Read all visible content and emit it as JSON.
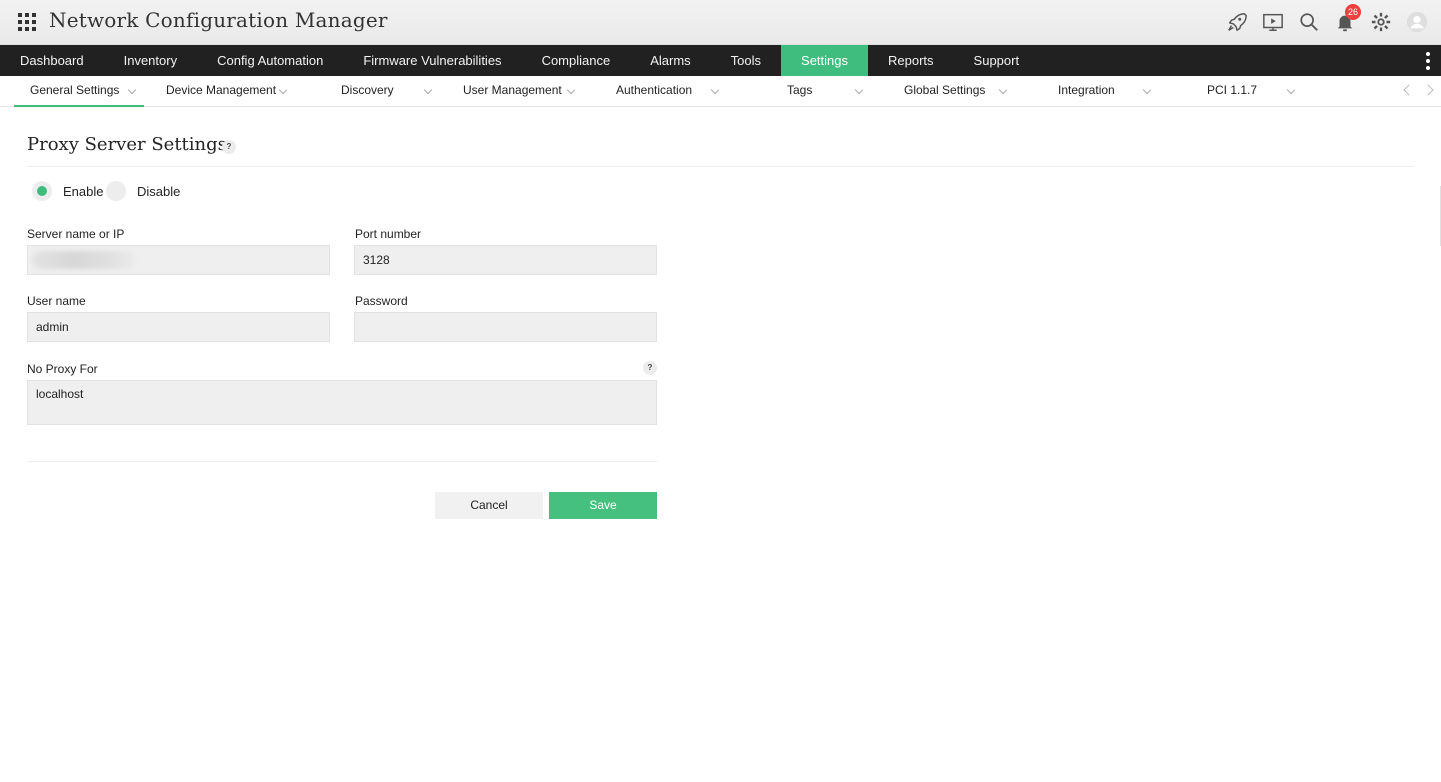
{
  "app": {
    "title": "Network Configuration Manager"
  },
  "header": {
    "icons": [
      "rocket-icon",
      "presentation-icon",
      "search-icon",
      "bell-icon",
      "gear-icon",
      "user-avatar-icon"
    ],
    "notification_count": "26"
  },
  "main_nav": {
    "items": [
      "Dashboard",
      "Inventory",
      "Config Automation",
      "Firmware Vulnerabilities",
      "Compliance",
      "Alarms",
      "Tools",
      "Settings",
      "Reports",
      "Support"
    ],
    "active": "Settings"
  },
  "sub_nav": {
    "items": [
      "General Settings",
      "Device Management",
      "Discovery",
      "User Management",
      "Authentication",
      "Tags",
      "Global Settings",
      "Integration",
      "PCI 1.1.7"
    ],
    "active": "General Settings"
  },
  "page": {
    "title": "Proxy Server Settings",
    "help_glyph": "?",
    "radio": {
      "enable_label": "Enable",
      "disable_label": "Disable",
      "selected": "Enable"
    },
    "fields": {
      "server": {
        "label": "Server name or IP",
        "value": ""
      },
      "port": {
        "label": "Port number",
        "value": "3128"
      },
      "username": {
        "label": "User name",
        "value": "admin"
      },
      "password": {
        "label": "Password",
        "value": ""
      },
      "no_proxy": {
        "label": "No Proxy For",
        "value": "localhost"
      }
    },
    "buttons": {
      "cancel": "Cancel",
      "save": "Save"
    }
  },
  "colors": {
    "accent": "#3fbd7e",
    "nav_bg": "#212121",
    "badge": "#e8413e"
  }
}
